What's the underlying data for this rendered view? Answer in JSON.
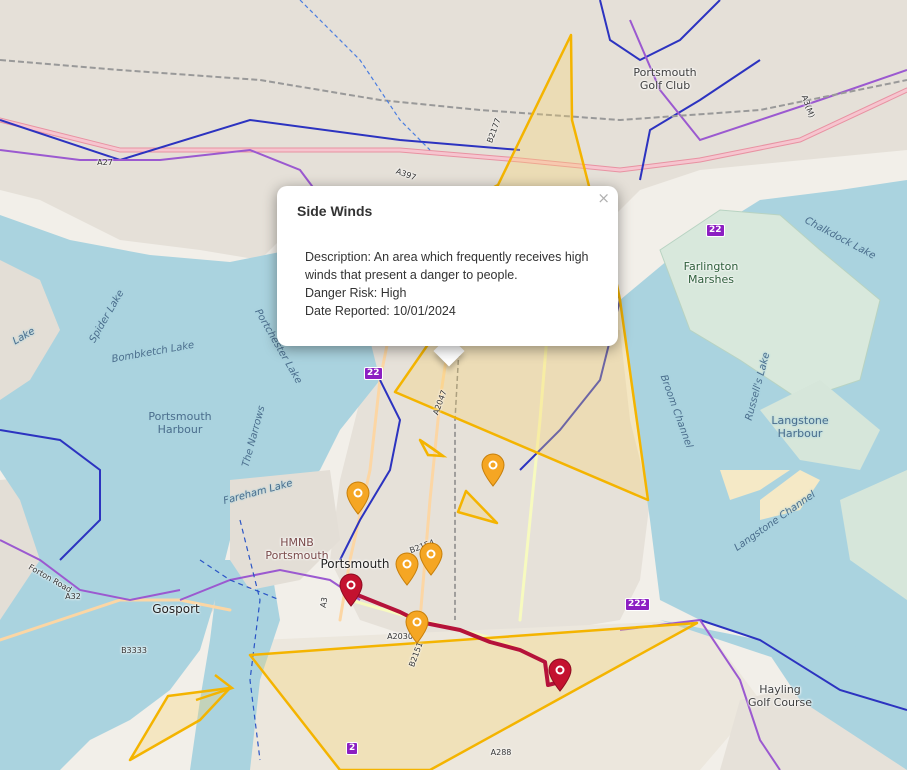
{
  "map": {
    "labels": {
      "portsmouth_golf_club": "Portsmouth\nGolf Club",
      "farlington_marshes": "Farlington\nMarshes",
      "chalkdock_lake": "Chalkdock Lake",
      "langstone_harbour": "Langstone\nHarbour",
      "portsmouth_harbour": "Portsmouth\nHarbour",
      "bombketch_lake": "Bombketch Lake",
      "spider_lake": "Spider Lake",
      "porchester_lake": "Portchester Lake",
      "the_narrows": "The Narrows",
      "fareham_lake": "Fareham Lake",
      "broom_channel": "Broom Channel",
      "langstone_channel": "Langstone Channel",
      "russells_lake": "Russell's Lake",
      "hmnb_portsmouth": "HMNB\nPortsmouth",
      "portsmouth": "Portsmouth",
      "gosport": "Gosport",
      "hayling_golf_course": "Hayling\nGolf Course",
      "foxton_road": "Forton Road",
      "a32": "A32",
      "b3333": "B3333",
      "a2030": "A2030",
      "b2151": "B2151",
      "b2154": "B2154",
      "a288": "A288",
      "a3": "A3",
      "a27": "A27",
      "a2047": "A2047",
      "b2177": "B2177",
      "a3m": "A3(M)",
      "a397": "A397",
      "lake_left": "Lake"
    },
    "route_shields": [
      "22",
      "22",
      "222",
      "2"
    ]
  },
  "popup": {
    "title": "Side Winds",
    "close": "×",
    "description": "Description: An area which frequently receives high winds that present a danger to people.",
    "danger": "Danger Risk: High",
    "date": "Date Reported: 10/01/2024"
  },
  "colors": {
    "water": "#aad3df",
    "land": "#f2efe9",
    "hazard_outline": "#f4b400",
    "hazard_fill": "#f9d56e",
    "marker_orange": "#f5a623",
    "marker_red": "#c4122f",
    "route_red": "#b5123a"
  },
  "markers": [
    {
      "type": "orange",
      "icon": "map-pin-icon"
    },
    {
      "type": "orange",
      "icon": "map-pin-icon"
    },
    {
      "type": "orange",
      "icon": "map-pin-icon"
    },
    {
      "type": "orange",
      "icon": "map-pin-icon"
    },
    {
      "type": "orange",
      "icon": "map-pin-icon"
    },
    {
      "type": "red",
      "icon": "map-pin-icon"
    },
    {
      "type": "red",
      "icon": "map-pin-icon"
    }
  ]
}
